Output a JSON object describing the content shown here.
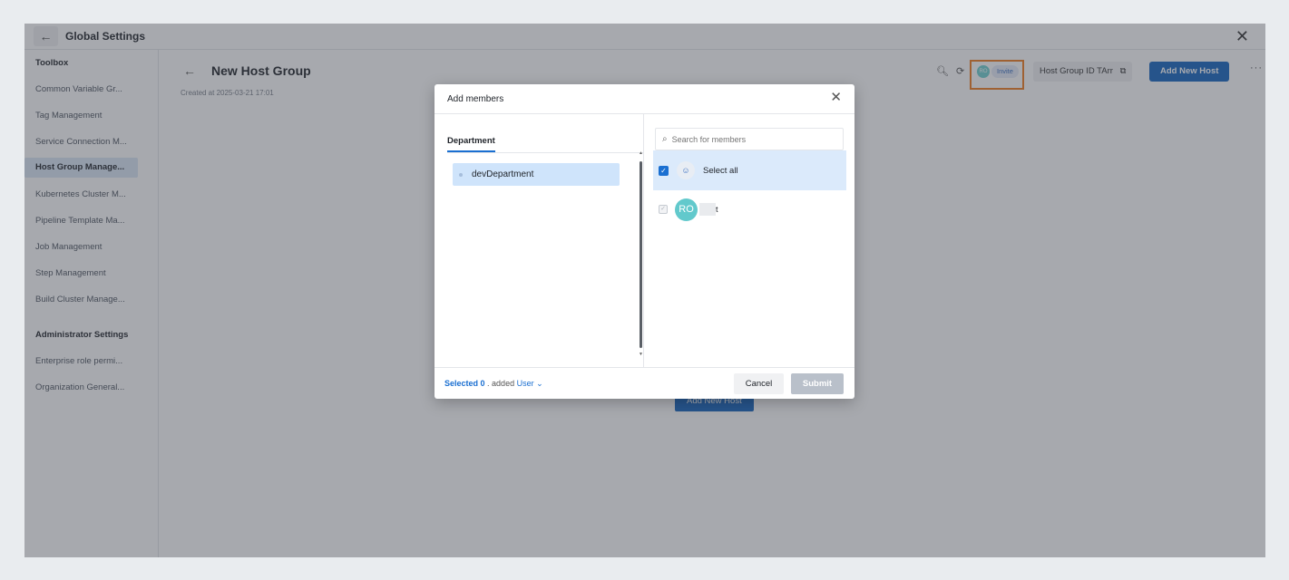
{
  "window": {
    "title": "Global Settings",
    "back_icon": "arrow-left-icon",
    "close_icon": "close-icon"
  },
  "sidebar": {
    "toolbox_heading": "Toolbox",
    "items": [
      {
        "label": "Common Variable Gr..."
      },
      {
        "label": "Tag Management"
      },
      {
        "label": "Service Connection M..."
      },
      {
        "label": "Host Group Manage..."
      },
      {
        "label": "Kubernetes Cluster M..."
      },
      {
        "label": "Pipeline Template Ma..."
      },
      {
        "label": "Job Management"
      },
      {
        "label": "Step Management"
      },
      {
        "label": "Build Cluster Manage..."
      }
    ],
    "admin_heading": "Administrator Settings",
    "admin_items": [
      {
        "label": "Enterprise role permi..."
      },
      {
        "label": "Organization General..."
      }
    ]
  },
  "page": {
    "title": "New Host Group",
    "created": "Created at 2025-03-21 17:01",
    "avatar_initials": "RO",
    "invite_label": "Invite",
    "host_group_id_label": "Host Group ID TArr",
    "add_new_host_label": "Add New Host",
    "more_label": "···",
    "center_add_host_label": "Add New Host"
  },
  "modal": {
    "title": "Add members",
    "department_tab": "Department",
    "departments": [
      {
        "label": "devDepartment"
      }
    ],
    "search_placeholder": "Search for members",
    "select_all_label": "Select all",
    "members": [
      {
        "initials": "RO",
        "name": "t"
      }
    ],
    "footer": {
      "selected_prefix": "Selected 0",
      "added_text": ". added",
      "user_type": "User"
    },
    "cancel_label": "Cancel",
    "submit_label": "Submit"
  },
  "colors": {
    "primary": "#1565c0",
    "highlight": "#f07c1f",
    "avatar": "#62c9cc",
    "selected_bg": "#cfe4fb"
  }
}
